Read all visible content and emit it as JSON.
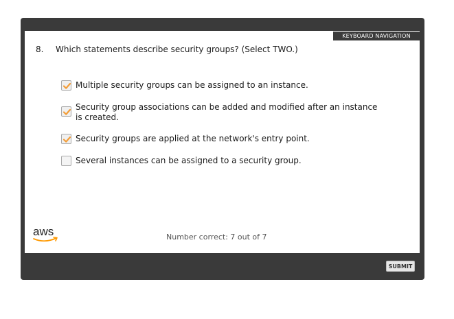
{
  "keyboard_nav_label": "KEYBOARD NAVIGATION",
  "question": {
    "number": "8.",
    "text": "Which statements describe security groups? (Select TWO.)"
  },
  "options": [
    {
      "label": "Multiple security groups can be assigned to an instance.",
      "checked": true
    },
    {
      "label": "Security group associations can be added and modified after an instance is created.",
      "checked": true
    },
    {
      "label": "Security groups are applied at the network's entry point.",
      "checked": true
    },
    {
      "label": "Several instances can be assigned to a security group.",
      "checked": false
    }
  ],
  "logo_text": "aws",
  "score_text": "Number correct: 7 out of 7",
  "submit_label": "SUBMIT",
  "colors": {
    "frame": "#3a3a3a",
    "check": "#f39c36",
    "logo": "#222222",
    "logo_smile": "#ff9900"
  }
}
